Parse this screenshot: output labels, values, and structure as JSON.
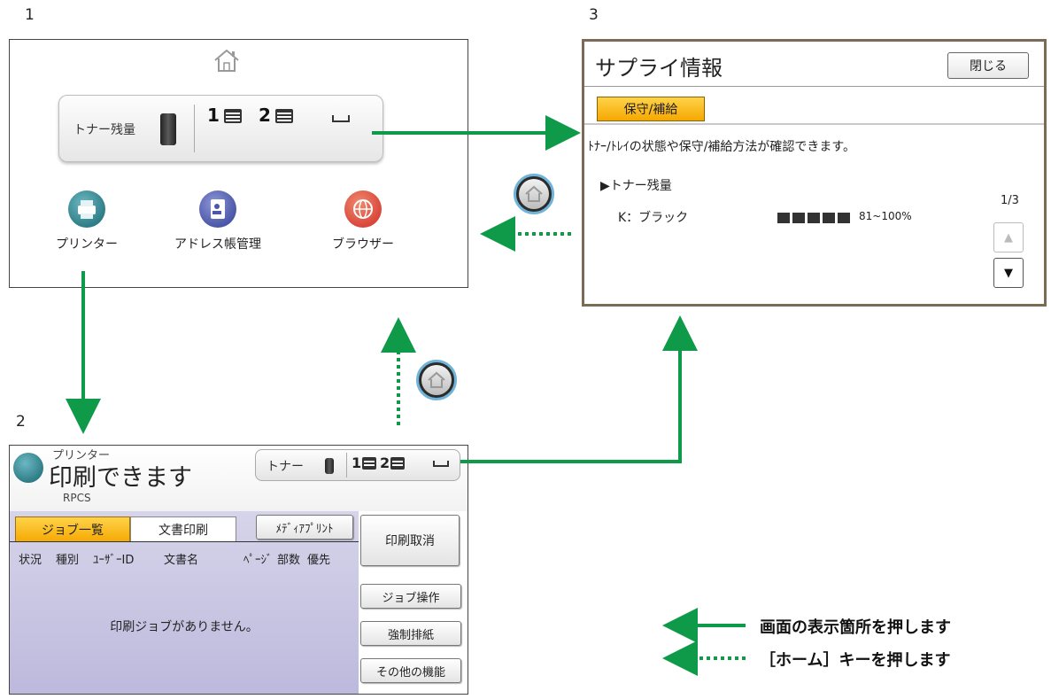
{
  "labels": {
    "p1": "1",
    "p2": "2",
    "p3": "3"
  },
  "home_screen": {
    "toner_label": "トナー残量",
    "tray1": "1",
    "tray2": "2",
    "apps": [
      {
        "label": "プリンター",
        "color": "#2f7d87"
      },
      {
        "label": "アドレス帳管理",
        "color": "#4b57a8"
      },
      {
        "label": "ブラウザー",
        "color": "#d9473a"
      }
    ]
  },
  "printer_screen": {
    "app_name": "プリンター",
    "status": "印刷できます",
    "sub": "RPCS",
    "toner_label": "トナー",
    "tray1": "1",
    "tray2": "2",
    "tabs": [
      "ジョブ一覧",
      "文書印刷"
    ],
    "media_print": "ﾒﾃﾞｨｱﾌﾟﾘﾝﾄ",
    "columns": [
      "状況",
      "種別",
      "ﾕｰｻﾞｰID",
      "文書名",
      "ﾍﾟｰｼﾞ",
      "部数",
      "優先"
    ],
    "empty_message": "印刷ジョブがありません。",
    "buttons": [
      "印刷取消",
      "ジョブ操作",
      "強制排紙",
      "その他の機能"
    ]
  },
  "supply_screen": {
    "title": "サプライ情報",
    "close": "閉じる",
    "tab": "保守/補給",
    "description": "ﾄﾅｰ/ﾄﾚｲの状態や保守/補給方法が確認できます。",
    "section": "▶トナー残量",
    "item_label": "K：ブラック",
    "level_text": "81~100%",
    "level_blocks": 5,
    "page_indicator": "1/3"
  },
  "legend": {
    "solid": "画面の表示箇所を押します",
    "dotted": "［ホーム］キーを押します"
  },
  "colors": {
    "arrow": "#0e9a48",
    "highlight_tab": "#f5a800"
  }
}
